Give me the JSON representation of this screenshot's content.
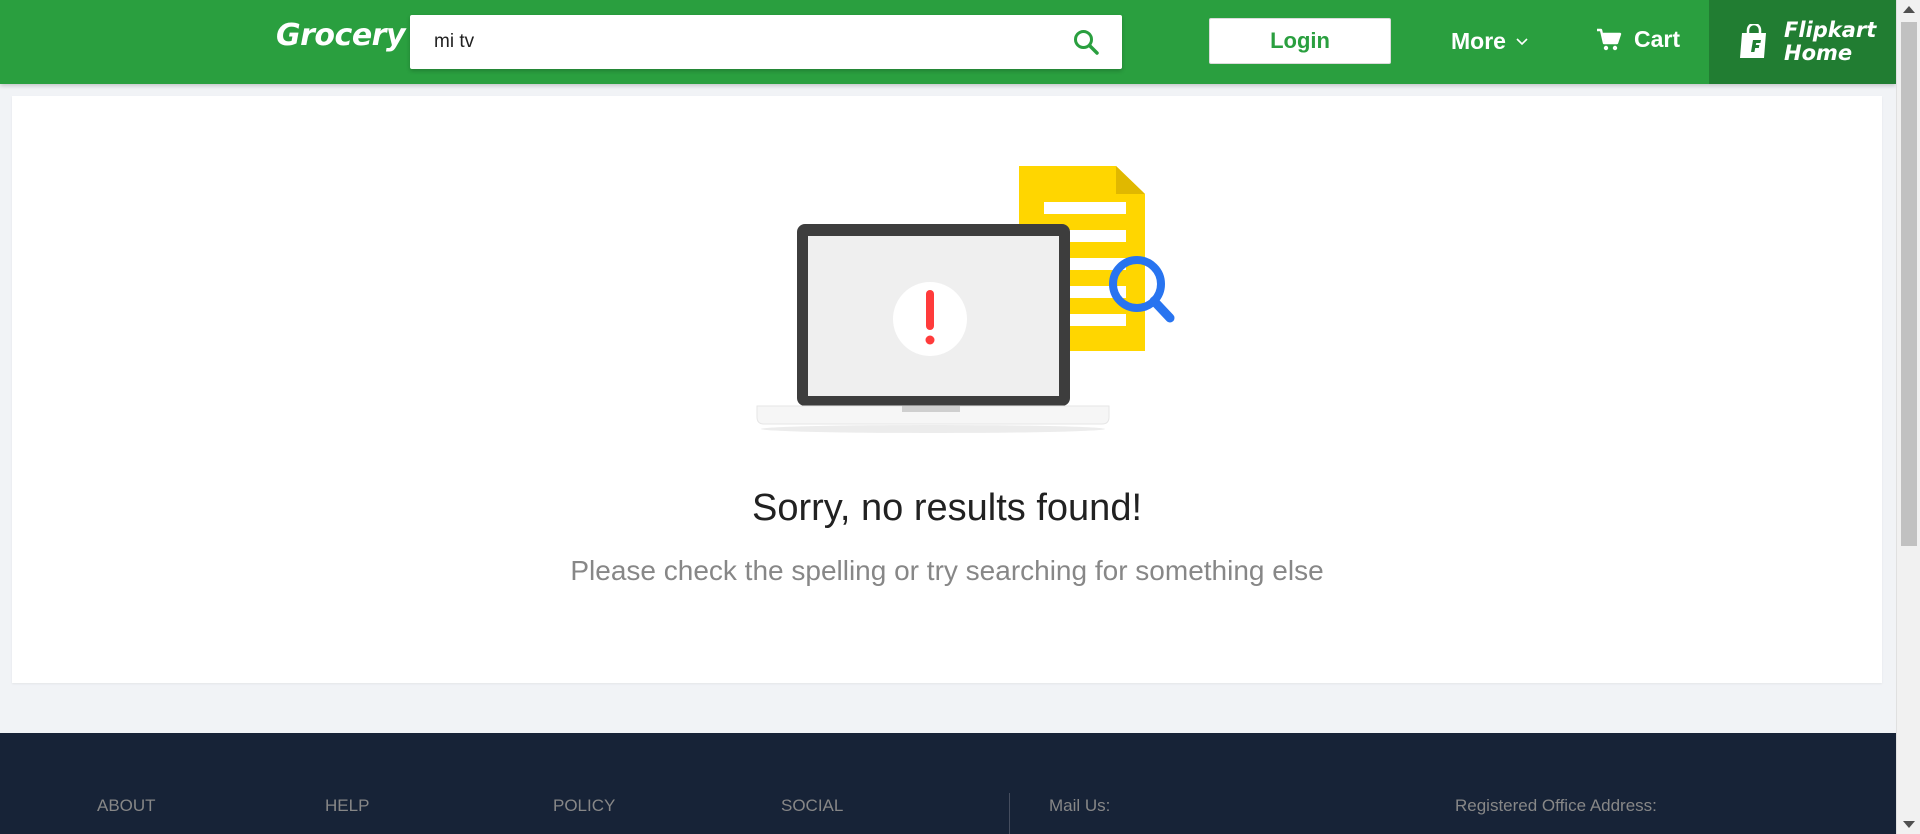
{
  "header": {
    "brand": "Grocery",
    "search_value": "mi tv",
    "login_label": "Login",
    "more_label": "More",
    "cart_label": "Cart",
    "flipkart_home_line1": "Flipkart",
    "flipkart_home_line2": "Home"
  },
  "main": {
    "title": "Sorry, no results found!",
    "subtitle": "Please check the spelling or try searching for something else"
  },
  "footer": {
    "columns": [
      "ABOUT",
      "HELP",
      "POLICY",
      "SOCIAL",
      "Mail Us:",
      "Registered Office Address:"
    ]
  },
  "colors": {
    "header_bg": "#2a9f3f",
    "home_bg": "#217d32",
    "footer_bg": "#172337",
    "page_bg": "#f1f3f6"
  },
  "icons": [
    "search-icon",
    "chevron-down-icon",
    "cart-icon",
    "flipkart-bag-icon",
    "no-results-illustration"
  ]
}
